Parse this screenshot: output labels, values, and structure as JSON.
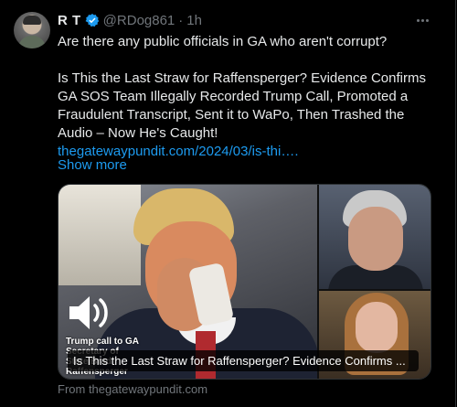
{
  "tweet": {
    "author_name": "R T",
    "handle": "@RDog861",
    "separator": "·",
    "time": "1h",
    "lines": [
      "Are there any public officials in GA who aren't corrupt?",
      "Is This the Last Straw for Raffensperger? Evidence Confirms GA SOS Team Illegally Recorded Trump Call, Promoted a Fraudulent Transcript, Sent it to WaPo, Then Trashed the Audio – Now He's Caught!"
    ],
    "link_text": "thegatewaypundit.com/2024/03/is-thi….",
    "show_more": "Show more"
  },
  "card": {
    "image_caption": "Trump call to GA Secretary of State Brad Raffensperger",
    "title": "Is This the Last Straw for Raffensperger? Evidence Confirms ...",
    "source": "From thegatewaypundit.com"
  },
  "icons": {
    "verified": "verified-badge-icon",
    "more": "more-options-icon",
    "speaker": "speaker-icon"
  },
  "colors": {
    "background": "#000000",
    "text": "#e7e9ea",
    "muted": "#71767b",
    "link": "#1d9bf0",
    "verified": "#1d9bf0"
  }
}
